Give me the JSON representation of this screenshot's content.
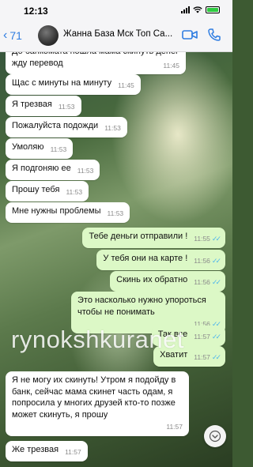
{
  "status_bar": {
    "time": "12:13"
  },
  "header": {
    "back_count": "71",
    "contact_name": "Жанна База Мск Топ Са..."
  },
  "messages": [
    {
      "dir": "in",
      "text": "До банкомата пошла мама скинуть денег жду перевод",
      "time": "11:45"
    },
    {
      "dir": "in",
      "text": "Щас с минуты на минуту",
      "time": "11:45"
    },
    {
      "dir": "in",
      "text": "Я трезвая",
      "time": "11:53"
    },
    {
      "dir": "in",
      "text": "Пожалуйста подожди",
      "time": "11:53"
    },
    {
      "dir": "in",
      "text": "Умоляю",
      "time": "11:53"
    },
    {
      "dir": "in",
      "text": "Я подгоняю ее",
      "time": "11:53"
    },
    {
      "dir": "in",
      "text": "Прошу тебя",
      "time": "11:53"
    },
    {
      "dir": "in",
      "text": "Мне нужны проблемы",
      "time": "11:53"
    },
    {
      "dir": "out",
      "text": "Тебе деньги отправили !",
      "time": "11:55"
    },
    {
      "dir": "out",
      "text": "У тебя они на карте !",
      "time": "11:56"
    },
    {
      "dir": "out",
      "text": "Скинь их обратно",
      "time": "11:56"
    },
    {
      "dir": "out",
      "text": "Это насколько нужно упороться чтобы не понимать",
      "time": "11:56"
    },
    {
      "dir": "out",
      "text": "Так все",
      "time": "11:57"
    },
    {
      "dir": "out",
      "text": "Хватит",
      "time": "11:57"
    },
    {
      "dir": "in",
      "text": "Я не могу их скинуть! Утром я подойду в банк, сейчас мама скинет часть одам, я попросила у многих друзей кто-то позже может скинуть, я прошу",
      "time": "11:57"
    },
    {
      "dir": "in",
      "text": "Же трезвая",
      "time": "11:57"
    }
  ],
  "watermark": "rynokshkuranet",
  "colors": {
    "incoming_bubble": "#ffffff",
    "outgoing_bubble": "#dcf8c6",
    "accent": "#2f7de1",
    "read_tick": "#4fb6ec"
  },
  "icons": [
    "back-chevron-icon",
    "video-call-icon",
    "phone-call-icon",
    "scroll-down-icon",
    "read-check-icon"
  ]
}
